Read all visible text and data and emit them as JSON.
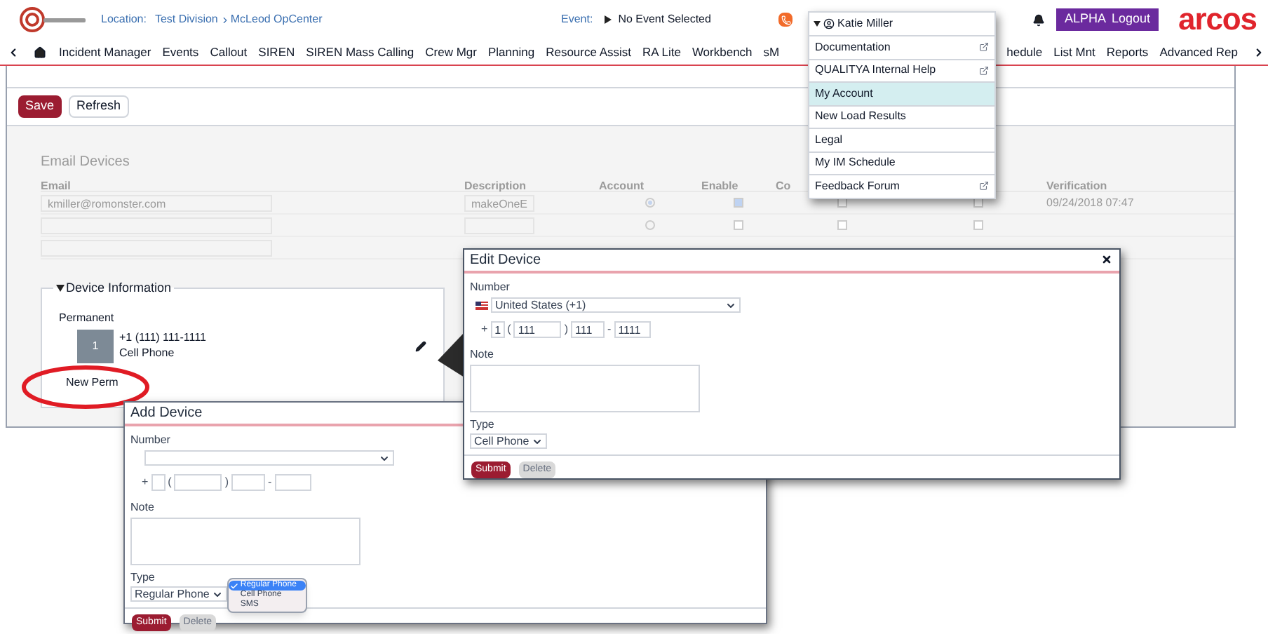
{
  "header": {
    "location_label": "Location:",
    "division": "Test Division",
    "opcenter": "McLeod OpCenter",
    "event_label": "Event:",
    "event": "No Event Selected",
    "alpha_label": "ALPHA",
    "logout_label": "Logout",
    "brand": "arcos"
  },
  "nav": [
    "Incident Manager",
    "Events",
    "Callout",
    "SIREN",
    "SIREN Mass Calling",
    "Crew Mgr",
    "Planning",
    "Resource Assist",
    "RA Lite",
    "Workbench",
    "sM",
    "hedule",
    "List Mnt",
    "Reports",
    "Advanced Rep"
  ],
  "toolbar": {
    "save": "Save",
    "refresh": "Refresh"
  },
  "email_devices": {
    "title": "Email Devices",
    "columns": [
      {
        "kind": "label",
        "label": "Email"
      },
      {
        "kind": "label",
        "label": "Description"
      },
      {
        "kind": "label",
        "label": "Account"
      },
      {
        "kind": "label",
        "label": "Enable"
      },
      {
        "kind": "label",
        "label": "Co"
      },
      {
        "kind": "covered"
      },
      {
        "kind": "label",
        "label": "Verification"
      }
    ],
    "rows": [
      [
        {
          "kind": "input",
          "value": "kmiller@romonster.com"
        },
        {
          "kind": "input",
          "value": "makeOneE"
        },
        {
          "kind": "radio",
          "checked": true
        },
        {
          "kind": "checkbox",
          "checked": true
        },
        {
          "kind": "checkbox",
          "checked": false
        },
        {
          "kind": "checkbox",
          "checked": false
        },
        {
          "kind": "text",
          "value": "09/24/2018 07:47"
        }
      ],
      [
        {
          "kind": "input"
        },
        {
          "kind": "input"
        },
        {
          "kind": "radio",
          "checked": false
        },
        {
          "kind": "checkbox",
          "checked": false
        },
        {
          "kind": "checkbox",
          "checked": false
        },
        {
          "kind": "checkbox",
          "checked": false
        },
        {
          "kind": "blank"
        }
      ],
      [
        {
          "kind": "input"
        }
      ]
    ]
  },
  "device_info": {
    "title": "Device Information",
    "expanded": true,
    "section": "Permanent",
    "devices": [
      {
        "index": "1",
        "number": "+1 (111) 111-1111",
        "type": "Cell Phone"
      }
    ],
    "new_button": "New Perm"
  },
  "user_menu": {
    "name": "Katie Miller",
    "items": [
      {
        "label": "Documentation",
        "external": true,
        "selected": false
      },
      {
        "label": "QUALITYA Internal Help",
        "external": true,
        "selected": false
      },
      {
        "label": "My Account",
        "external": false,
        "selected": true
      },
      {
        "label": "New Load Results",
        "external": false,
        "selected": false
      },
      {
        "label": "Legal",
        "external": false,
        "selected": false
      },
      {
        "label": "My IM Schedule",
        "external": false,
        "selected": false
      },
      {
        "label": "Feedback Forum",
        "external": true,
        "selected": false
      }
    ]
  },
  "edit_device": {
    "title": "Edit Device",
    "number_label": "Number",
    "country": "United States (+1)",
    "phone": [
      {
        "kind": "sep",
        "text": "+"
      },
      {
        "kind": "field",
        "value": "1"
      },
      {
        "kind": "sep",
        "text": "("
      },
      {
        "kind": "field",
        "value": "111"
      },
      {
        "kind": "sep",
        "text": ")"
      },
      {
        "kind": "field",
        "value": "111"
      },
      {
        "kind": "sep",
        "text": "-"
      },
      {
        "kind": "field",
        "value": "1111"
      }
    ],
    "note_label": "Note",
    "type_label": "Type",
    "type": "Cell Phone",
    "submit": "Submit",
    "delete": "Delete"
  },
  "add_device": {
    "title": "Add Device",
    "number_label": "Number",
    "phone": [
      {
        "kind": "sep",
        "text": "+"
      },
      {
        "kind": "field"
      },
      {
        "kind": "sep",
        "text": "("
      },
      {
        "kind": "field"
      },
      {
        "kind": "sep",
        "text": ")"
      },
      {
        "kind": "field"
      },
      {
        "kind": "sep",
        "text": "-"
      },
      {
        "kind": "field"
      }
    ],
    "note_label": "Note",
    "type_label": "Type",
    "type": "Regular Phone",
    "type_options": [
      {
        "label": "Regular Phone",
        "selected": true
      },
      {
        "label": "Cell Phone",
        "selected": false
      },
      {
        "label": "SMS",
        "selected": false
      }
    ],
    "submit": "Submit",
    "delete": "Delete"
  }
}
